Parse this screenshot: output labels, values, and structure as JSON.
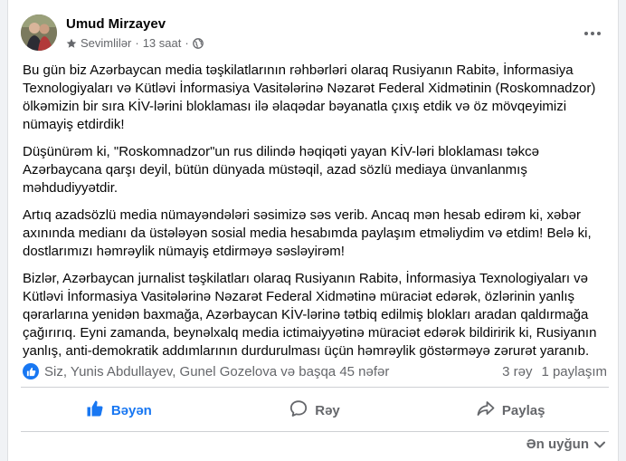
{
  "post": {
    "author": "Umud Mirzayev",
    "audience": "Sevimlilər",
    "separator": "·",
    "time": "13 saat",
    "paragraphs": [
      "Bu gün biz Azərbaycan media təşkilatlarının  rəhbərləri olaraq Rusiyanın Rabitə, İnformasiya Texnologiyaları və Kütləvi İnformasiya Vasitələrinə Nəzarət Federal Xidmətinin (Roskomnadzor) ölkəmizin bir sıra KİV-lərini bloklaması ilə əlaqədar bəyanatla çıxış etdik və öz mövqeyimizi nümayiş etdirdik!",
      "Düşünürəm ki, \"Roskomnadzor\"un rus dilində həqiqəti yayan KİV-ləri bloklaması  təkcə Azərbaycana qarşı deyil, bütün dünyada müstəqil, azad sözlü mediaya ünvanlanmış məhdudiyyətdir.",
      "Artıq azadsözlü media nümayəndələri səsimizə səs verib. Ancaq mən hesab edirəm ki, xəbər axınında medianı da üstələyən sosial media hesabımda paylaşım etməliydim və etdim!  Belə ki, dostlarımızı həmrəylik nümayiş etdirməyə səsləyirəm!",
      "Bizlər, Azərbaycan jurnalist təşkilatları olaraq Rusiyanın Rabitə, İnformasiya Texnologiyaları və Kütləvi İnformasiya Vasitələrinə Nəzarət Federal Xidmətinə müraciət edərək, özlərinin yanlış qərarlarına yenidən baxmağa, Azərbaycan KİV-lərinə tətbiq edilmiş blokları aradan qaldırmağa çağırırıq. Eyni zamanda, beynəlxalq media ictimaiyyətinə müraciət edərək bildiririk ki, Rusiyanın yanlış, anti-demokratik addımlarının durdurulması üçün həmrəylik göstərməyə zərurət yaranıb."
    ]
  },
  "stats": {
    "reactions": "Siz, Yunis Abdullayev, Gunel Gozelova və başqa 45 nəfər",
    "comments": "3 rəy",
    "shares": "1 paylaşım"
  },
  "actions": {
    "like": "Bəyən",
    "comment": "Rəy",
    "share": "Paylaş"
  },
  "sort": {
    "label": "Ən uyğun"
  },
  "icons": {
    "audience": "star-icon",
    "privacy": "globe-icon",
    "more": "more-dots-icon",
    "reaction": "like-reaction-icon",
    "like": "thumbs-up-icon",
    "comment": "comment-bubble-icon",
    "share": "share-arrow-icon",
    "sort": "chevron-down-icon"
  },
  "colors": {
    "accent": "#1877f2",
    "secondary_text": "#65676b"
  }
}
